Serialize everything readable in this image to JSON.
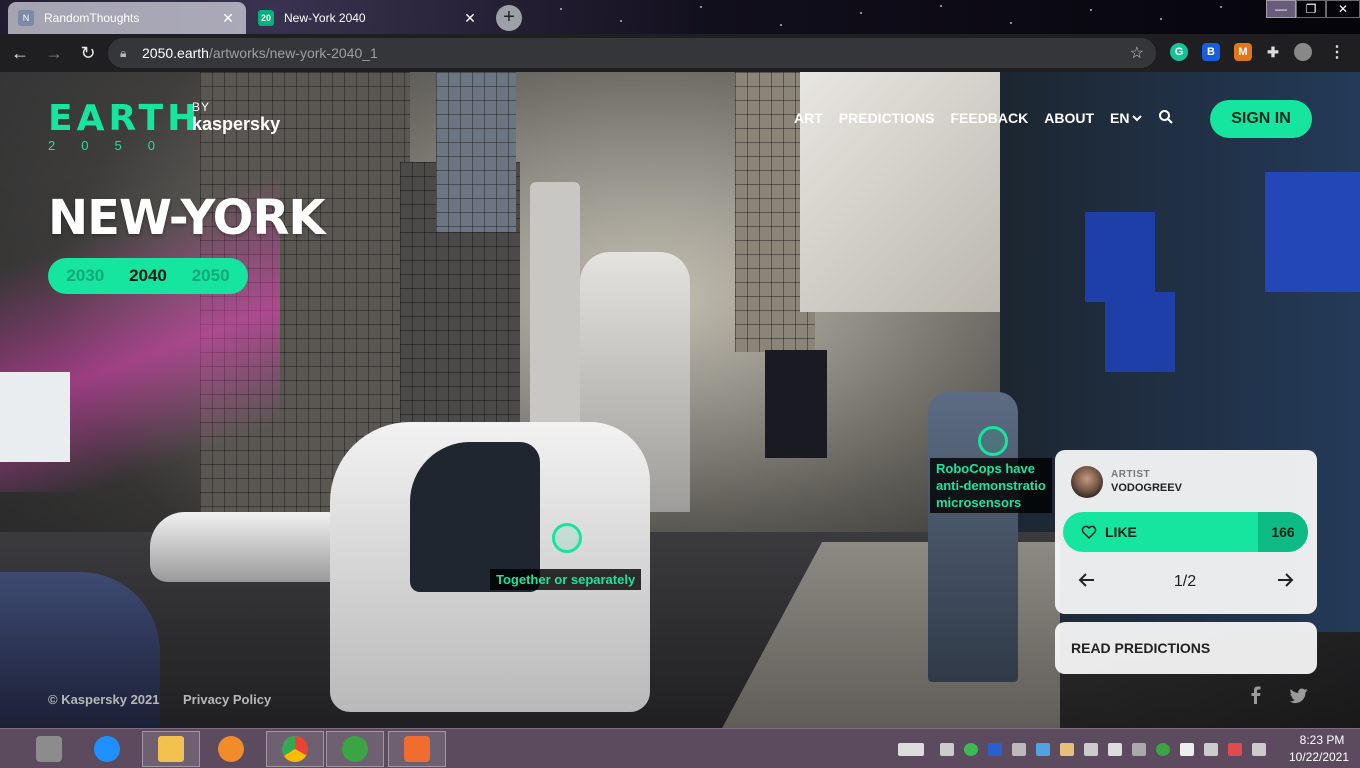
{
  "browser": {
    "tabs": [
      {
        "label": "RandomThoughts",
        "favicon": "N",
        "active": false
      },
      {
        "label": "New-York 2040",
        "favicon": "20 50",
        "active": true
      }
    ],
    "new_tab_glyph": "+",
    "address": {
      "host": "2050.earth",
      "path": "/artworks/new-york-2040_1"
    },
    "window_controls": [
      "minimize-icon",
      "restore-icon",
      "close-icon"
    ],
    "extensions": [
      "grammarly-icon",
      "bitwarden-icon",
      "metamask-icon",
      "puzzle-icon",
      "profile-icon",
      "menu-icon"
    ]
  },
  "site": {
    "logo_word": "EARTH",
    "logo_year": "2050",
    "logo_by": "BY",
    "logo_brand": "kaspersky",
    "nav": [
      "ART",
      "PREDICTIONS",
      "FEEDBACK",
      "ABOUT"
    ],
    "language": "EN",
    "signin_label": "SIGN IN",
    "city_title": "NEW-YORK",
    "years": [
      "2030",
      "2040",
      "2050"
    ],
    "selected_year": "2040",
    "hotspots": [
      {
        "label": "RoboCops have\nanti-demonstratio\nmicrosensors"
      },
      {
        "label": "Together or separately"
      }
    ],
    "card": {
      "artist_kicker": "ARTIST",
      "artist_name": "VODOGREEV",
      "like_label": "LIKE",
      "like_count": "166",
      "pager": "1/2"
    },
    "read_predictions": "READ PREDICTIONS",
    "footer_copyright": "© Kaspersky 2021",
    "footer_privacy": "Privacy Policy"
  },
  "taskbar": {
    "time": "8:23 PM",
    "date": "10/22/2021",
    "apps": [
      "tool-icon",
      "ie-icon",
      "folder-icon",
      "ccleaner-icon",
      "chrome-icon",
      "utorrent-icon",
      "media-icon"
    ]
  },
  "colors": {
    "accent": "#16e5a0",
    "accent_dark": "#0fbb84",
    "taskbar": "#5c4a5e"
  }
}
